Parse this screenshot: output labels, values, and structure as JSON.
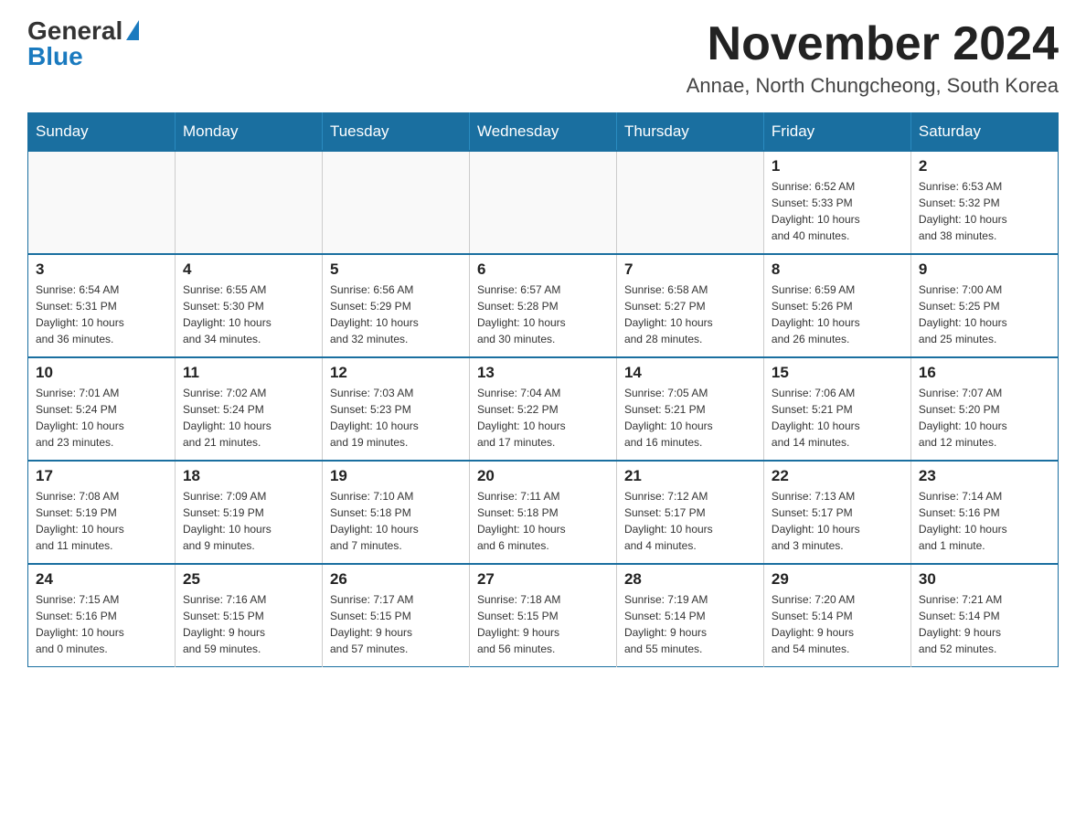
{
  "logo": {
    "general": "General",
    "blue": "Blue"
  },
  "title": "November 2024",
  "location": "Annae, North Chungcheong, South Korea",
  "days_of_week": [
    "Sunday",
    "Monday",
    "Tuesday",
    "Wednesday",
    "Thursday",
    "Friday",
    "Saturday"
  ],
  "weeks": [
    [
      {
        "day": "",
        "info": ""
      },
      {
        "day": "",
        "info": ""
      },
      {
        "day": "",
        "info": ""
      },
      {
        "day": "",
        "info": ""
      },
      {
        "day": "",
        "info": ""
      },
      {
        "day": "1",
        "info": "Sunrise: 6:52 AM\nSunset: 5:33 PM\nDaylight: 10 hours\nand 40 minutes."
      },
      {
        "day": "2",
        "info": "Sunrise: 6:53 AM\nSunset: 5:32 PM\nDaylight: 10 hours\nand 38 minutes."
      }
    ],
    [
      {
        "day": "3",
        "info": "Sunrise: 6:54 AM\nSunset: 5:31 PM\nDaylight: 10 hours\nand 36 minutes."
      },
      {
        "day": "4",
        "info": "Sunrise: 6:55 AM\nSunset: 5:30 PM\nDaylight: 10 hours\nand 34 minutes."
      },
      {
        "day": "5",
        "info": "Sunrise: 6:56 AM\nSunset: 5:29 PM\nDaylight: 10 hours\nand 32 minutes."
      },
      {
        "day": "6",
        "info": "Sunrise: 6:57 AM\nSunset: 5:28 PM\nDaylight: 10 hours\nand 30 minutes."
      },
      {
        "day": "7",
        "info": "Sunrise: 6:58 AM\nSunset: 5:27 PM\nDaylight: 10 hours\nand 28 minutes."
      },
      {
        "day": "8",
        "info": "Sunrise: 6:59 AM\nSunset: 5:26 PM\nDaylight: 10 hours\nand 26 minutes."
      },
      {
        "day": "9",
        "info": "Sunrise: 7:00 AM\nSunset: 5:25 PM\nDaylight: 10 hours\nand 25 minutes."
      }
    ],
    [
      {
        "day": "10",
        "info": "Sunrise: 7:01 AM\nSunset: 5:24 PM\nDaylight: 10 hours\nand 23 minutes."
      },
      {
        "day": "11",
        "info": "Sunrise: 7:02 AM\nSunset: 5:24 PM\nDaylight: 10 hours\nand 21 minutes."
      },
      {
        "day": "12",
        "info": "Sunrise: 7:03 AM\nSunset: 5:23 PM\nDaylight: 10 hours\nand 19 minutes."
      },
      {
        "day": "13",
        "info": "Sunrise: 7:04 AM\nSunset: 5:22 PM\nDaylight: 10 hours\nand 17 minutes."
      },
      {
        "day": "14",
        "info": "Sunrise: 7:05 AM\nSunset: 5:21 PM\nDaylight: 10 hours\nand 16 minutes."
      },
      {
        "day": "15",
        "info": "Sunrise: 7:06 AM\nSunset: 5:21 PM\nDaylight: 10 hours\nand 14 minutes."
      },
      {
        "day": "16",
        "info": "Sunrise: 7:07 AM\nSunset: 5:20 PM\nDaylight: 10 hours\nand 12 minutes."
      }
    ],
    [
      {
        "day": "17",
        "info": "Sunrise: 7:08 AM\nSunset: 5:19 PM\nDaylight: 10 hours\nand 11 minutes."
      },
      {
        "day": "18",
        "info": "Sunrise: 7:09 AM\nSunset: 5:19 PM\nDaylight: 10 hours\nand 9 minutes."
      },
      {
        "day": "19",
        "info": "Sunrise: 7:10 AM\nSunset: 5:18 PM\nDaylight: 10 hours\nand 7 minutes."
      },
      {
        "day": "20",
        "info": "Sunrise: 7:11 AM\nSunset: 5:18 PM\nDaylight: 10 hours\nand 6 minutes."
      },
      {
        "day": "21",
        "info": "Sunrise: 7:12 AM\nSunset: 5:17 PM\nDaylight: 10 hours\nand 4 minutes."
      },
      {
        "day": "22",
        "info": "Sunrise: 7:13 AM\nSunset: 5:17 PM\nDaylight: 10 hours\nand 3 minutes."
      },
      {
        "day": "23",
        "info": "Sunrise: 7:14 AM\nSunset: 5:16 PM\nDaylight: 10 hours\nand 1 minute."
      }
    ],
    [
      {
        "day": "24",
        "info": "Sunrise: 7:15 AM\nSunset: 5:16 PM\nDaylight: 10 hours\nand 0 minutes."
      },
      {
        "day": "25",
        "info": "Sunrise: 7:16 AM\nSunset: 5:15 PM\nDaylight: 9 hours\nand 59 minutes."
      },
      {
        "day": "26",
        "info": "Sunrise: 7:17 AM\nSunset: 5:15 PM\nDaylight: 9 hours\nand 57 minutes."
      },
      {
        "day": "27",
        "info": "Sunrise: 7:18 AM\nSunset: 5:15 PM\nDaylight: 9 hours\nand 56 minutes."
      },
      {
        "day": "28",
        "info": "Sunrise: 7:19 AM\nSunset: 5:14 PM\nDaylight: 9 hours\nand 55 minutes."
      },
      {
        "day": "29",
        "info": "Sunrise: 7:20 AM\nSunset: 5:14 PM\nDaylight: 9 hours\nand 54 minutes."
      },
      {
        "day": "30",
        "info": "Sunrise: 7:21 AM\nSunset: 5:14 PM\nDaylight: 9 hours\nand 52 minutes."
      }
    ]
  ]
}
